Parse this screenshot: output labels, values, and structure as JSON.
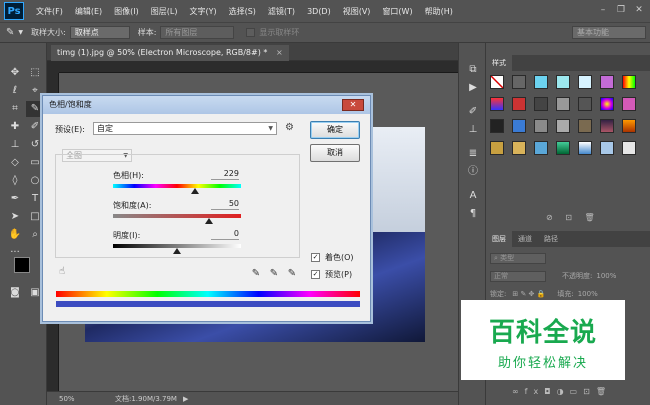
{
  "app": {
    "logo": "Ps"
  },
  "menubar": {
    "items": [
      "文件(F)",
      "编辑(E)",
      "图像(I)",
      "图层(L)",
      "文字(Y)",
      "选择(S)",
      "滤镜(T)",
      "3D(D)",
      "视图(V)",
      "窗口(W)",
      "帮助(H)"
    ]
  },
  "options": {
    "sample_size_label": "取样大小:",
    "sample_size_value": "取样点",
    "sample_label": "样本:",
    "sample_value": "所有图层",
    "show_ring_label": "显示取样环",
    "workspace": "基本功能"
  },
  "document": {
    "tab_title": "timg (1).jpg @ 50% (Electron Microscope, RGB/8#) *",
    "zoom": "50%",
    "doc_size": "文档:1.90M/3.79M"
  },
  "dialog": {
    "title": "色相/饱和度",
    "preset_label": "预设(E):",
    "preset_value": "自定",
    "channel_value": "全图",
    "hue_label": "色相(H):",
    "hue_value": "229",
    "saturation_label": "饱和度(A):",
    "saturation_value": "50",
    "lightness_label": "明度(I):",
    "lightness_value": "0",
    "ok_label": "确定",
    "cancel_label": "取消",
    "colorize_label": "着色(O)",
    "preview_label": "预览(P)",
    "hue_level": 0.64,
    "saturation_level": 0.75,
    "lightness_level": 0.5
  },
  "panels": {
    "styles_tab": "样式",
    "layers_tab": "图层",
    "channels_tab": "通道",
    "paths_tab": "路径",
    "kind_label": "类型",
    "blend_mode": "正常",
    "opacity_label": "不透明度:",
    "opacity_value": "100%",
    "lock_label": "锁定:",
    "fill_label": "填充:",
    "fill_value": "100%"
  },
  "watermark": {
    "main": "百科全说",
    "sub": "助你轻松解决"
  },
  "colors": {
    "accent_green": "#19a94f",
    "dialog_bg": "#f0f0f0"
  }
}
